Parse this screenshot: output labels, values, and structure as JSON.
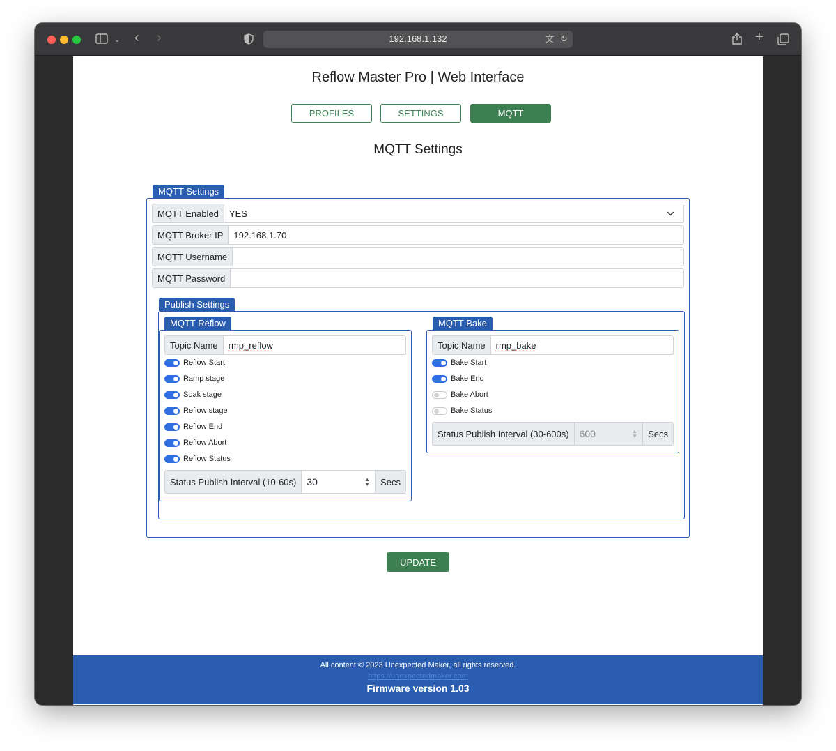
{
  "browser": {
    "url": "192.168.1.132"
  },
  "page": {
    "title": "Reflow Master Pro | Web Interface",
    "nav": [
      "PROFILES",
      "SETTINGS",
      "MQTT"
    ],
    "section_title": "MQTT Settings",
    "update_label": "UPDATE"
  },
  "mqtt": {
    "legend": "MQTT Settings",
    "enabled_label": "MQTT Enabled",
    "enabled_value": "YES",
    "broker_label": "MQTT Broker IP",
    "broker_value": "192.168.1.70",
    "username_label": "MQTT Username",
    "username_value": "",
    "password_label": "MQTT Password",
    "password_value": ""
  },
  "publish": {
    "legend": "Publish Settings",
    "reflow": {
      "legend": "MQTT Reflow",
      "topic_label": "Topic Name",
      "topic_value": "rmp_reflow",
      "toggles": [
        {
          "label": "Reflow Start",
          "on": true
        },
        {
          "label": "Ramp stage",
          "on": true
        },
        {
          "label": "Soak stage",
          "on": true
        },
        {
          "label": "Reflow stage",
          "on": true
        },
        {
          "label": "Reflow End",
          "on": true
        },
        {
          "label": "Reflow Abort",
          "on": true
        },
        {
          "label": "Reflow Status",
          "on": true
        }
      ],
      "interval_label": "Status Publish Interval (10-60s)",
      "interval_value": "30",
      "interval_unit": "Secs"
    },
    "bake": {
      "legend": "MQTT Bake",
      "topic_label": "Topic Name",
      "topic_value": "rmp_bake",
      "toggles": [
        {
          "label": "Bake Start",
          "on": true
        },
        {
          "label": "Bake End",
          "on": true
        },
        {
          "label": "Bake Abort",
          "on": false
        },
        {
          "label": "Bake Status",
          "on": false
        }
      ],
      "interval_label": "Status Publish Interval (30-600s)",
      "interval_value": "600",
      "interval_unit": "Secs"
    }
  },
  "footer": {
    "copyright": "All content © 2023 Unexpected Maker, all rights reserved.",
    "link": "https://unexpectedmaker.com",
    "firmware": "Firmware version 1.03"
  },
  "colors": {
    "primary_blue": "#2a5db0",
    "green": "#3e7f51",
    "toggle_on": "#2f6fe0"
  }
}
